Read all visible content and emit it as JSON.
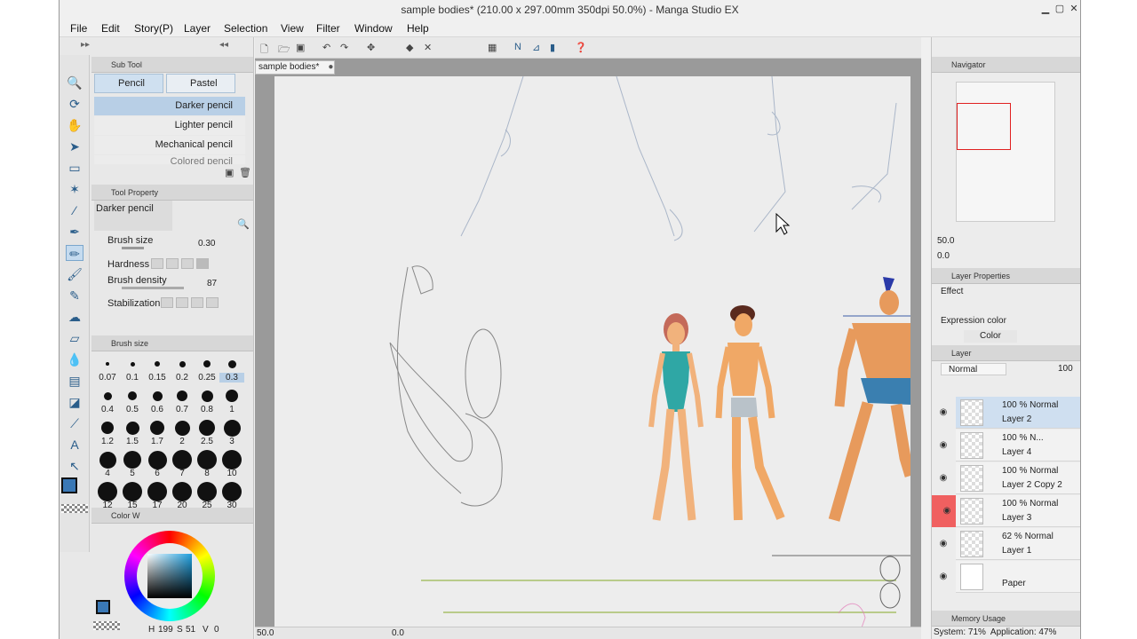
{
  "window": {
    "title": "sample bodies* (210.00 x 297.00mm 350dpi 50.0%) - Manga Studio EX"
  },
  "menu": [
    "File",
    "Edit",
    "Story(P)",
    "Layer",
    "Selection",
    "View",
    "Filter",
    "Window",
    "Help"
  ],
  "document_tab": "sample bodies*",
  "sub_tool": {
    "title": "Sub Tool",
    "tabs": [
      "Pencil",
      "Pastel"
    ],
    "brushes": [
      "Darker pencil",
      "Lighter pencil",
      "Mechanical pencil",
      "Colored pencil"
    ]
  },
  "tool_property": {
    "title": "Tool Property",
    "current_brush": "Darker pencil",
    "brush_size_label": "Brush size",
    "brush_size_value": "0.30",
    "hardness_label": "Hardness",
    "density_label": "Brush density",
    "density_value": "87",
    "stabilization_label": "Stabilization"
  },
  "brush_size_panel": {
    "title": "Brush size",
    "sizes": [
      "0.07",
      "0.1",
      "0.15",
      "0.2",
      "0.25",
      "0.3",
      "0.4",
      "0.5",
      "0.6",
      "0.7",
      "0.8",
      "1",
      "1.2",
      "1.5",
      "1.7",
      "2",
      "2.5",
      "3",
      "4",
      "5",
      "6",
      "7",
      "8",
      "10",
      "12",
      "15",
      "17",
      "20",
      "25",
      "30"
    ]
  },
  "color_wheel": {
    "title": "Color W",
    "readout_h": "H",
    "h": "199",
    "s_label": "S",
    "s": "51",
    "v_label": "V",
    "v": "0"
  },
  "canvas_status": {
    "zoom": "50.0",
    "angle": "0.0"
  },
  "navigator": {
    "title": "Navigator",
    "zoom": "50.0",
    "rotate": "0.0"
  },
  "layer_properties": {
    "title": "Layer Properties",
    "effect_label": "Effect",
    "expression_label": "Expression color",
    "expression_value": "Color"
  },
  "layer_panel": {
    "title": "Layer",
    "blend_mode": "Normal",
    "opacity": "100",
    "layers": [
      {
        "opacity": "100 %",
        "mode": "Normal",
        "name": "Layer 2"
      },
      {
        "opacity": "100 %",
        "mode": "N...",
        "name": "Layer 4"
      },
      {
        "opacity": "100 %",
        "mode": "Normal",
        "name": "Layer 2 Copy 2"
      },
      {
        "opacity": "100 %",
        "mode": "Normal",
        "name": "Layer 3"
      },
      {
        "opacity": "62 %",
        "mode": "Normal",
        "name": "Layer 1"
      },
      {
        "opacity": "",
        "mode": "",
        "name": "Paper"
      }
    ]
  },
  "memory": {
    "title": "Memory Usage",
    "status": "System: 71%  Application: 47%"
  },
  "colors": {
    "accent": "#3a78b5",
    "selected_layer": "#cfdff0",
    "red_layer_marker": "#f06060"
  }
}
